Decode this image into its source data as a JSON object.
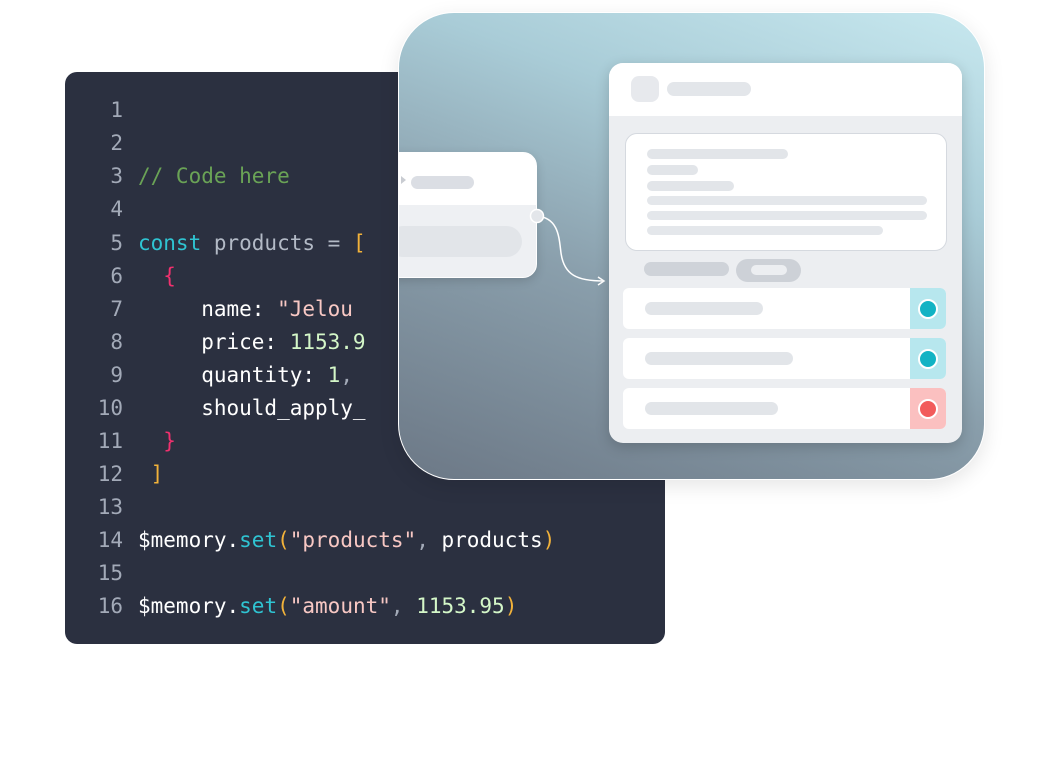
{
  "editor": {
    "lines": [
      {
        "n": "1",
        "tokens": []
      },
      {
        "n": "2",
        "tokens": []
      },
      {
        "n": "3",
        "tokens": [
          {
            "t": "// Code here",
            "c": "comment"
          }
        ]
      },
      {
        "n": "4",
        "tokens": []
      },
      {
        "n": "5",
        "tokens": [
          {
            "t": "const",
            "c": "kw"
          },
          {
            "t": " products",
            "c": "var"
          },
          {
            "t": " = ",
            "c": "op"
          },
          {
            "t": "[",
            "c": "bracket"
          }
        ]
      },
      {
        "n": "6",
        "tokens": [
          {
            "t": "  {",
            "c": "brace"
          }
        ]
      },
      {
        "n": "7",
        "tokens": [
          {
            "t": "     name: ",
            "c": "key"
          },
          {
            "t": "\"Jelou",
            "c": "str"
          }
        ]
      },
      {
        "n": "8",
        "tokens": [
          {
            "t": "     price: ",
            "c": "key"
          },
          {
            "t": "1153.9",
            "c": "num"
          }
        ]
      },
      {
        "n": "9",
        "tokens": [
          {
            "t": "     quantity: ",
            "c": "key"
          },
          {
            "t": "1",
            "c": "num"
          },
          {
            "t": ",",
            "c": "punct"
          }
        ]
      },
      {
        "n": "10",
        "tokens": [
          {
            "t": "     should_apply_",
            "c": "key"
          }
        ]
      },
      {
        "n": "11",
        "tokens": [
          {
            "t": "  }",
            "c": "brace"
          }
        ]
      },
      {
        "n": "12",
        "tokens": [
          {
            "t": " ]",
            "c": "bracket"
          }
        ]
      },
      {
        "n": "13",
        "tokens": []
      },
      {
        "n": "14",
        "tokens": [
          {
            "t": "$memory.",
            "c": "key"
          },
          {
            "t": "set",
            "c": "fn"
          },
          {
            "t": "(",
            "c": "paren"
          },
          {
            "t": "\"products\"",
            "c": "str"
          },
          {
            "t": ", ",
            "c": "punct"
          },
          {
            "t": "products",
            "c": "key"
          },
          {
            "t": ")",
            "c": "paren"
          }
        ]
      },
      {
        "n": "15",
        "tokens": []
      },
      {
        "n": "16",
        "tokens": [
          {
            "t": "$memory.",
            "c": "key"
          },
          {
            "t": "set",
            "c": "fn"
          },
          {
            "t": "(",
            "c": "paren"
          },
          {
            "t": "\"amount\"",
            "c": "str"
          },
          {
            "t": ", ",
            "c": "punct"
          },
          {
            "t": "1153.95",
            "c": "num"
          },
          {
            "t": ")",
            "c": "paren"
          }
        ]
      }
    ]
  },
  "preview": {
    "rows": [
      {
        "status": "active",
        "color": "#12b3c4",
        "bg": "#b7e7ee"
      },
      {
        "status": "active",
        "color": "#12b3c4",
        "bg": "#b7e7ee"
      },
      {
        "status": "error",
        "color": "#f25b5b",
        "bg": "#fbc0c0"
      }
    ]
  }
}
